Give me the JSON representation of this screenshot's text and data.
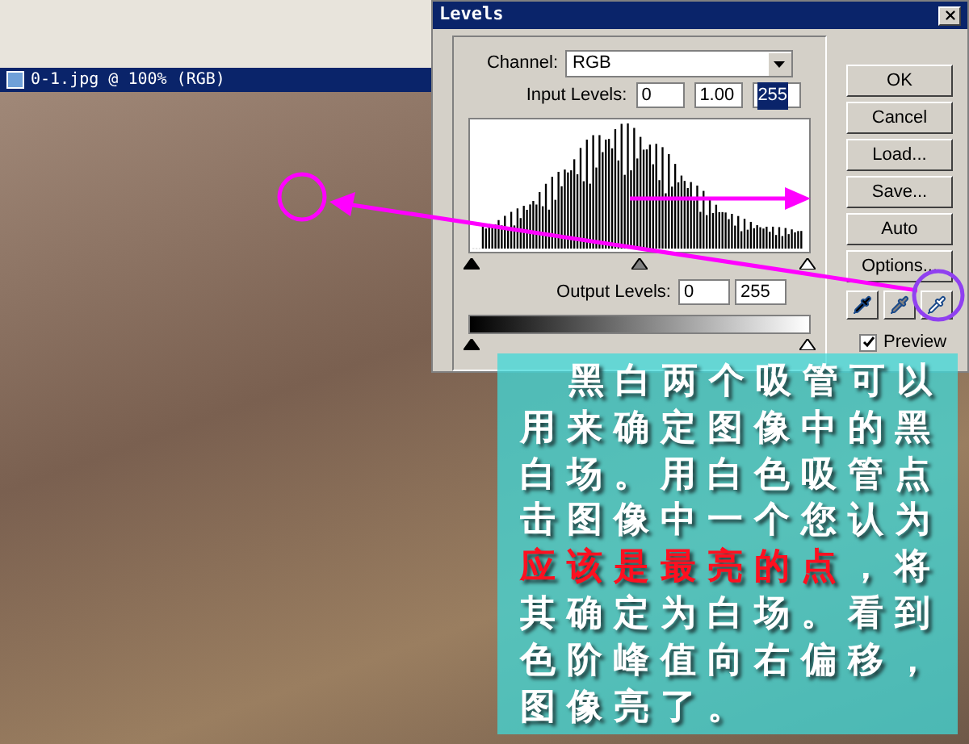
{
  "image_window": {
    "title": "0-1.jpg @ 100% (RGB)"
  },
  "dialog": {
    "title": "Levels",
    "channel": {
      "label": "Channel:",
      "value": "RGB"
    },
    "input_levels": {
      "label": "Input Levels:",
      "fields": [
        {
          "value": "0",
          "selected": false
        },
        {
          "value": "1.00",
          "selected": false
        },
        {
          "value": "255",
          "selected": true
        }
      ]
    },
    "output_levels": {
      "label": "Output Levels:",
      "fields": [
        "0",
        "255"
      ]
    },
    "buttons": [
      "OK",
      "Cancel",
      "Load...",
      "Save...",
      "Auto",
      "Options..."
    ],
    "preview": {
      "label": "Preview",
      "checked": true
    }
  },
  "caption": {
    "lines": [
      [
        {
          "text": "黑白两个吸管可以",
          "highlighted": false
        }
      ],
      [
        {
          "text": "用来确定图像中的黑",
          "highlighted": false
        }
      ],
      [
        {
          "text": "白场。用白色吸管点",
          "highlighted": false
        }
      ],
      [
        {
          "text": "击图像中一个您认为",
          "highlighted": false
        }
      ],
      [
        {
          "text": "应该是最亮的点",
          "highlighted": true
        },
        {
          "text": "，将",
          "highlighted": false
        }
      ],
      [
        {
          "text": "其确定为白场。看到",
          "highlighted": false
        }
      ],
      [
        {
          "text": "色阶峰值向右偏移，",
          "highlighted": false
        }
      ],
      [
        {
          "text": "图像亮了。",
          "highlighted": false
        }
      ]
    ]
  }
}
